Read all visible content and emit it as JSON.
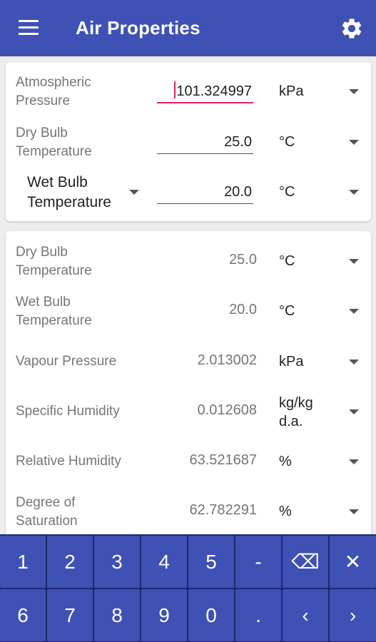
{
  "appbar": {
    "title": "Air Properties",
    "menu_icon": "menu-icon",
    "settings_icon": "gear-icon"
  },
  "inputs": {
    "pressure": {
      "label": "Atmospheric Pressure",
      "value": "101.324997",
      "unit": "kPa"
    },
    "dry_bulb": {
      "label": "Dry Bulb Temperature",
      "value": "25.0",
      "unit": "°C"
    },
    "wet_bulb": {
      "label": "Wet Bulb Temperature",
      "value": "20.0",
      "unit": "°C"
    }
  },
  "results": [
    {
      "label": "Dry Bulb Temperature",
      "value": "25.0",
      "unit": "°C"
    },
    {
      "label": "Wet Bulb Temperature",
      "value": "20.0",
      "unit": "°C"
    },
    {
      "label": "Vapour Pressure",
      "value": "2.013002",
      "unit": "kPa"
    },
    {
      "label": "Specific Humidity",
      "value": "0.012608",
      "unit": "kg/kg d.a."
    },
    {
      "label": "Relative Humidity",
      "value": "63.521687",
      "unit": "%"
    },
    {
      "label": "Degree of Saturation",
      "value": "62.782291",
      "unit": "%"
    }
  ],
  "keypad": {
    "row1": [
      "1",
      "2",
      "3",
      "4",
      "5",
      "-",
      "⌫",
      "✕"
    ],
    "row2": [
      "6",
      "7",
      "8",
      "9",
      "0",
      ".",
      "‹",
      "›"
    ]
  },
  "colors": {
    "primary": "#3f51b5",
    "accent": "#e91e63",
    "keyboard_bg": "#1e2a6e"
  }
}
